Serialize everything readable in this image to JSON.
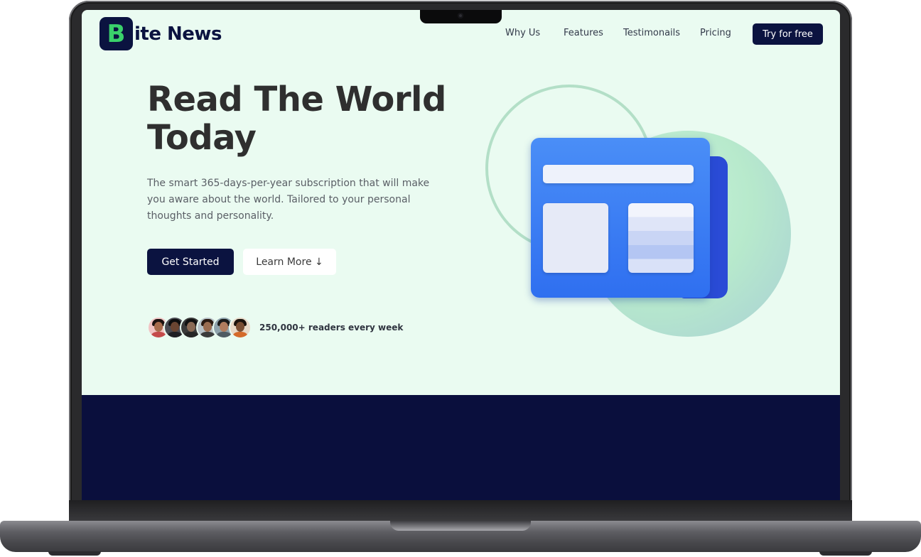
{
  "site": {
    "logo_letter": "B",
    "logo_word": "ite News"
  },
  "nav": {
    "links": [
      "Why Us",
      "Features",
      "Testimonails",
      "Pricing"
    ],
    "cta": "Try for free"
  },
  "hero": {
    "title_line1": "Read The World",
    "title_line2": "Today",
    "subtitle": "The smart 365-days-per-year subscription that will make you aware about the world. Tailored to your personal thoughts and personality.",
    "primary_button": "Get Started",
    "secondary_button": "Learn More ↓"
  },
  "social_proof": {
    "text": "250,000+ readers every week"
  },
  "colors": {
    "brand_navy": "#0b1340",
    "brand_green": "#3ad16b",
    "background": "#eafbf1",
    "dark_band": "#0a0f3d"
  },
  "icons": {
    "illustration": "newspaper-illustration",
    "arrow": "arrow-down-icon"
  }
}
